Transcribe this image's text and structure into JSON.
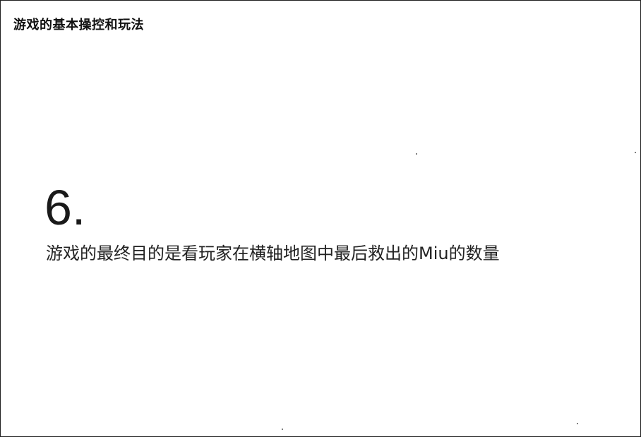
{
  "header": {
    "title": "游戏的基本操控和玩法"
  },
  "step": {
    "number": "6.",
    "description": "游戏的最终目的是看玩家在横轴地图中最后救出的Miu的数量"
  },
  "colors": {
    "background": "#ffffff",
    "border": "#1f1f1f",
    "text": "#1a1a1a"
  }
}
